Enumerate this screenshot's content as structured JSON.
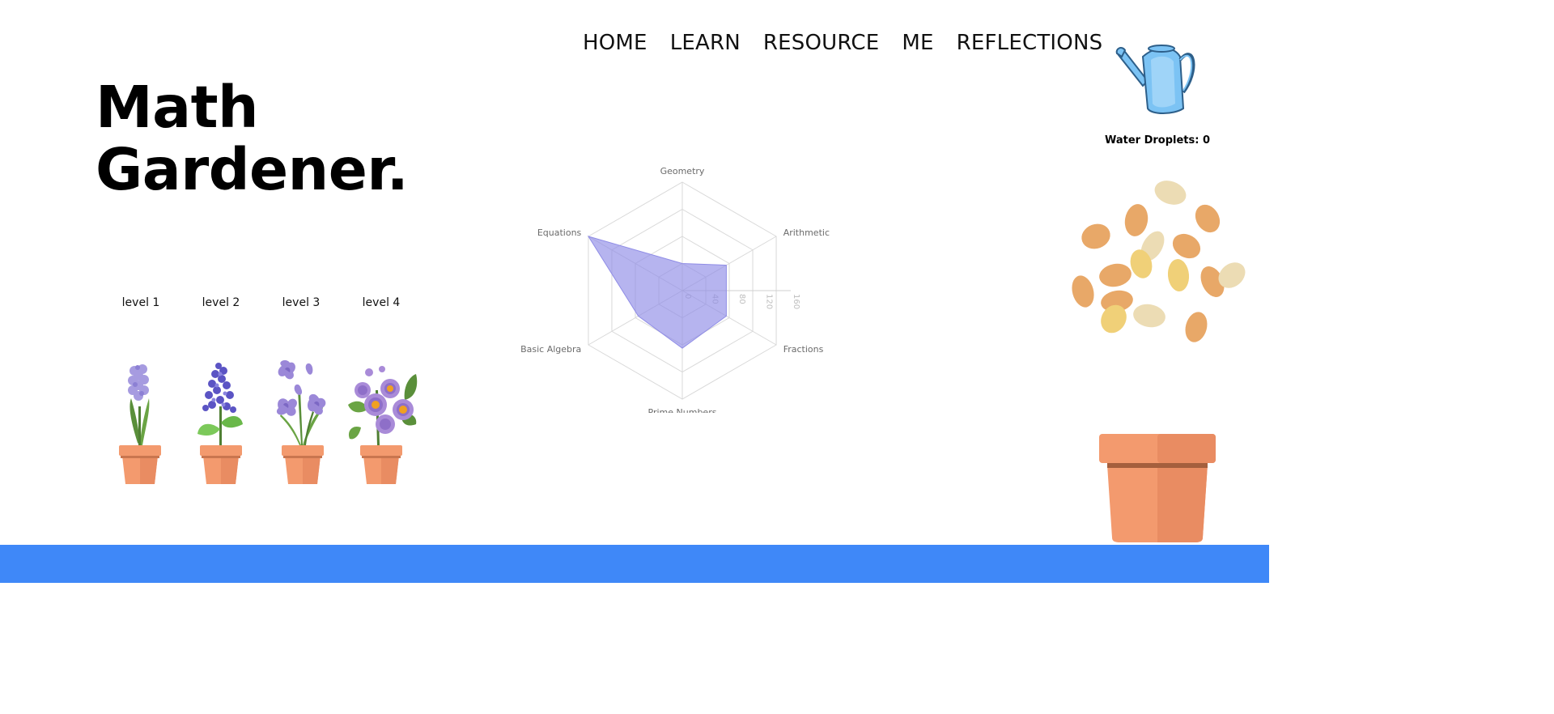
{
  "nav": {
    "items": [
      "HOME",
      "LEARN",
      "RESOURCE",
      "ME",
      "REFLECTIONS"
    ]
  },
  "header": {
    "title_line1": "Math",
    "title_line2": "Gardener."
  },
  "levels": [
    "level 1",
    "level 2",
    "level 3",
    "level 4"
  ],
  "water": {
    "label": "Water Droplets: 0"
  },
  "colors": {
    "footer": "#3f88f8",
    "radar_fill": "#8f8ce6",
    "pot": "#f39a6e",
    "watering_can": "#7cc3f4"
  },
  "icons": [
    "watering-can-icon",
    "seeds-icon",
    "flower-pot-icon"
  ],
  "chart_data": {
    "type": "radar",
    "axes": [
      "Geometry",
      "Arithmetic",
      "Fractions",
      "Prime Numbers",
      "Basic Algebra",
      "Equations"
    ],
    "values": [
      40,
      75,
      75,
      85,
      75,
      160
    ],
    "ticks": [
      "0",
      "40",
      "80",
      "120",
      "160"
    ],
    "range": [
      0,
      160
    ]
  }
}
